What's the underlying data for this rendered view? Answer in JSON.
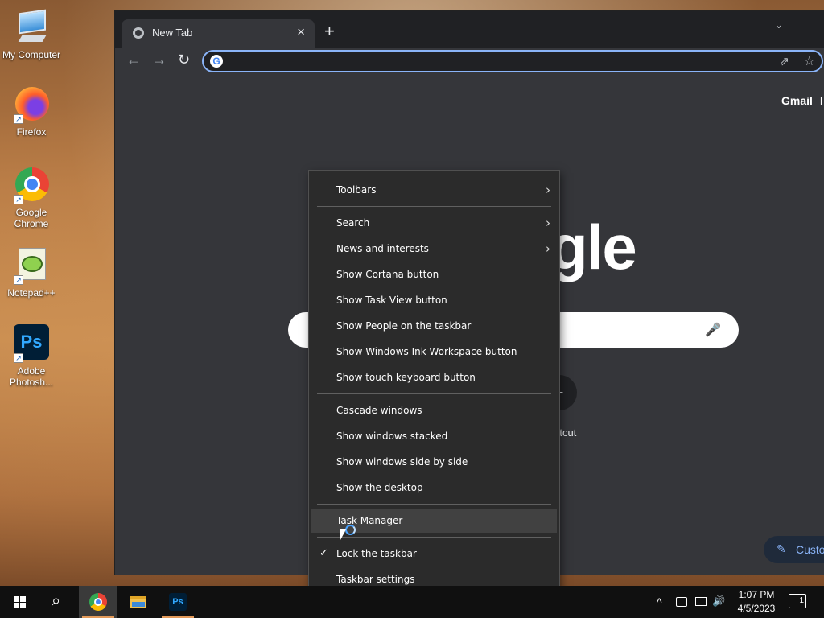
{
  "desktop": {
    "icons": [
      {
        "label": "My Computer",
        "icon": "computer-icon"
      },
      {
        "label": "Firefox",
        "icon": "firefox-icon"
      },
      {
        "label": "Google Chrome",
        "icon": "chrome-icon"
      },
      {
        "label": "Notepad++",
        "icon": "notepadpp-icon"
      },
      {
        "label": "Adobe Photosh...",
        "icon": "photoshop-icon",
        "glyph": "Ps"
      }
    ]
  },
  "browser": {
    "tab_title": "New Tab",
    "tab_close": "×",
    "new_tab": "+",
    "tab_search": "⌄",
    "window_min": "—",
    "nav": {
      "back": "←",
      "forward": "→",
      "reload": "↻"
    },
    "omnibox": {
      "value": "",
      "placeholder": ""
    },
    "omnibox_google": "G",
    "share": "⇗",
    "bookmark": "☆",
    "header_links": [
      "Gmail",
      "I"
    ],
    "logo_fragment": "gle",
    "search_mic": "🎤",
    "shortcut_add": "+",
    "shortcut_label": "rtcut",
    "customize": {
      "icon": "✎",
      "label": "Custo"
    }
  },
  "context_menu": {
    "items": [
      {
        "label": "Toolbars",
        "submenu": true
      },
      {
        "label": "Search",
        "submenu": true
      },
      {
        "label": "News and interests",
        "submenu": true
      },
      {
        "label": "Show Cortana button"
      },
      {
        "label": "Show Task View button"
      },
      {
        "label": "Show People on the taskbar"
      },
      {
        "label": "Show Windows Ink Workspace button"
      },
      {
        "label": "Show touch keyboard button"
      },
      {
        "label": "Cascade windows"
      },
      {
        "label": "Show windows stacked"
      },
      {
        "label": "Show windows side by side"
      },
      {
        "label": "Show the desktop"
      },
      {
        "label": "Task Manager",
        "highlighted": true
      },
      {
        "label": "Lock the taskbar",
        "checked": true
      },
      {
        "label": "Taskbar settings"
      }
    ],
    "submenu_arrow": "›",
    "check_mark": "✓"
  },
  "taskbar": {
    "start": "⊞",
    "search": "⌕",
    "apps": [
      "chrome",
      "file-explorer",
      "photoshop"
    ],
    "ps_glyph": "Ps",
    "tray": {
      "chevron": "^",
      "volume": "🔊"
    },
    "clock_time": "1:07 PM",
    "clock_date": "4/5/2023",
    "notification_count": "1"
  }
}
